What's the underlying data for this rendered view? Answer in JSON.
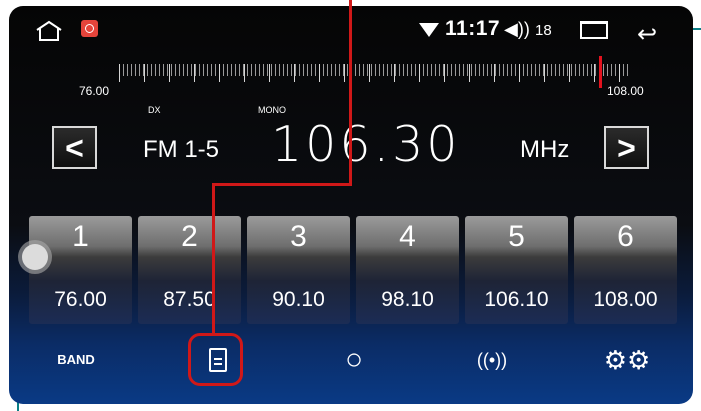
{
  "status": {
    "time": "11:17",
    "volume_icon": "◀))",
    "volume": "18",
    "icons": [
      "home-icon",
      "app-icon",
      "wifi-icon",
      "volume-icon",
      "recent-apps-icon",
      "back-icon"
    ]
  },
  "tuner": {
    "scale_min": "76.00",
    "scale_max": "108.00",
    "dx_label": "DX",
    "mono_label": "MONO",
    "band": "FM 1-5",
    "frequency": "106.30",
    "unit": "MHz",
    "prev_label": "<",
    "next_label": ">",
    "needle_fraction": 0.94
  },
  "presets": [
    {
      "number": "1",
      "freq": "76.00"
    },
    {
      "number": "2",
      "freq": "87.50"
    },
    {
      "number": "3",
      "freq": "90.10"
    },
    {
      "number": "4",
      "freq": "98.10"
    },
    {
      "number": "5",
      "freq": "106.10"
    },
    {
      "number": "6",
      "freq": "108.00"
    }
  ],
  "toolbar": {
    "band_label": "BAND",
    "search_glyph": "○",
    "radio_glyph": "((•))",
    "settings_glyph": "⚙⚙"
  },
  "colors": {
    "annotation": "#d01818",
    "guide": "#0a7f86",
    "needle": "#e3121e"
  }
}
